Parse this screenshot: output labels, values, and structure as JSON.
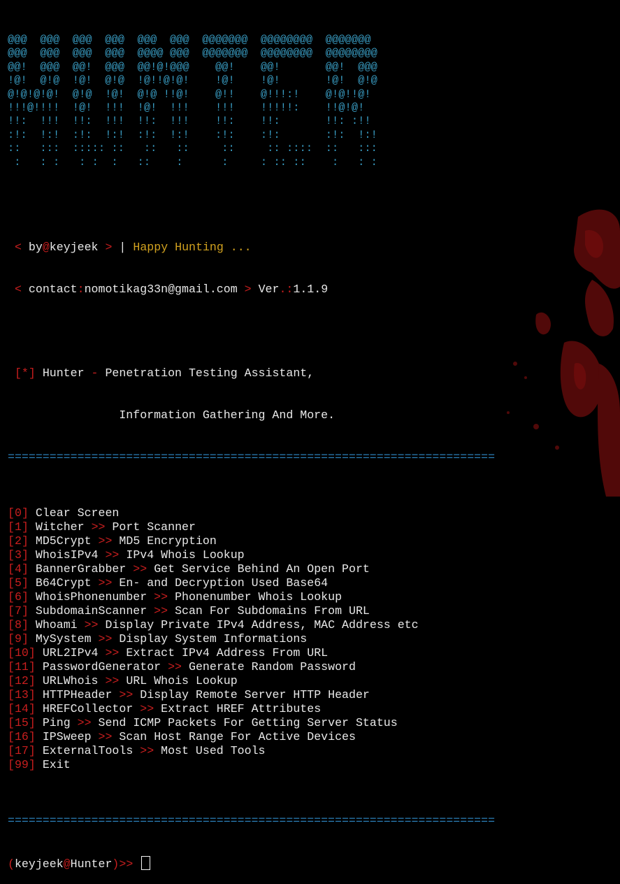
{
  "banner": {
    "ascii_lines": [
      "@@@  @@@  @@@  @@@  @@@  @@@  @@@@@@@  @@@@@@@@  @@@@@@@",
      "@@@  @@@  @@@  @@@  @@@@ @@@  @@@@@@@  @@@@@@@@  @@@@@@@@",
      "@@!  @@@  @@!  @@@  @@!@!@@@    @@!    @@!       @@!  @@@",
      "!@!  @!@  !@!  @!@  !@!!@!@!    !@!    !@!       !@!  @!@",
      "@!@!@!@!  @!@  !@!  @!@ !!@!    @!!    @!!!:!    @!@!!@!",
      "!!!@!!!!  !@!  !!!  !@!  !!!    !!!    !!!!!:    !!@!@!",
      "!!:  !!!  !!:  !!!  !!:  !!!    !!:    !!:       !!: :!!",
      ":!:  !:!  :!:  !:!  :!:  !:!    :!:    :!:       :!:  !:!",
      "::   :::  ::::: ::   ::   ::     ::     :: ::::  ::   :::",
      " :   : :   : :  :   ::    :      :     : :: ::    :   : :"
    ]
  },
  "info": {
    "by_lt": "<",
    "by_text": "by",
    "by_at": "@",
    "by_user": "keyjeek",
    "by_gt": ">",
    "by_pipe": "|",
    "tagline": "Happy Hunting ...",
    "contact_lt": "<",
    "contact_label": "contact",
    "contact_colon": ":",
    "contact_email": "nomotikag33n@gmail.com",
    "contact_gt": ">",
    "ver_label": "Ver",
    "ver_punct": ".:",
    "ver_value": "1.1.9"
  },
  "description": {
    "marker": "[*]",
    "line1_name": "Hunter",
    "line1_dash": "-",
    "line1_rest": "Penetration Testing Assistant,",
    "line2": "Information Gathering And More."
  },
  "separator": "======================================================================",
  "menu": [
    {
      "num": "0",
      "name": "Clear Screen",
      "desc": ""
    },
    {
      "num": "1",
      "name": "Witcher",
      "desc": "Port Scanner"
    },
    {
      "num": "2",
      "name": "MD5Crypt",
      "desc": "MD5 Encryption"
    },
    {
      "num": "3",
      "name": "WhoisIPv4",
      "desc": "IPv4 Whois Lookup"
    },
    {
      "num": "4",
      "name": "BannerGrabber",
      "desc": "Get Service Behind An Open Port"
    },
    {
      "num": "5",
      "name": "B64Crypt",
      "desc": "En- and Decryption Used Base64"
    },
    {
      "num": "6",
      "name": "WhoisPhonenumber",
      "desc": "Phonenumber Whois Lookup"
    },
    {
      "num": "7",
      "name": "SubdomainScanner",
      "desc": "Scan For Subdomains From URL"
    },
    {
      "num": "8",
      "name": "Whoami",
      "desc": "Display Private IPv4 Address, MAC Address etc"
    },
    {
      "num": "9",
      "name": "MySystem",
      "desc": "Display System Informations"
    },
    {
      "num": "10",
      "name": "URL2IPv4",
      "desc": "Extract IPv4 Address From URL"
    },
    {
      "num": "11",
      "name": "PasswordGenerator",
      "desc": "Generate Random Password"
    },
    {
      "num": "12",
      "name": "URLWhois",
      "desc": "URL Whois Lookup"
    },
    {
      "num": "13",
      "name": "HTTPHeader",
      "desc": "Display Remote Server HTTP Header"
    },
    {
      "num": "14",
      "name": "HREFCollector",
      "desc": "Extract HREF Attributes"
    },
    {
      "num": "15",
      "name": "Ping",
      "desc": "Send ICMP Packets For Getting Server Status"
    },
    {
      "num": "16",
      "name": "IPSweep",
      "desc": "Scan Host Range For Active Devices"
    },
    {
      "num": "17",
      "name": "ExternalTools",
      "desc": "Most Used Tools"
    },
    {
      "num": "99",
      "name": "Exit",
      "desc": ""
    }
  ],
  "arrow": ">>",
  "prompt": {
    "open": "(",
    "user": "keyjeek",
    "at": "@",
    "host": "Hunter",
    "close": ")",
    "arrow": ">>"
  },
  "colors": {
    "ascii": "#3a9fc6",
    "red": "#c81e1e",
    "yellow": "#d2a21f",
    "text": "#e8e8e8",
    "separator": "#2b7fb8"
  }
}
